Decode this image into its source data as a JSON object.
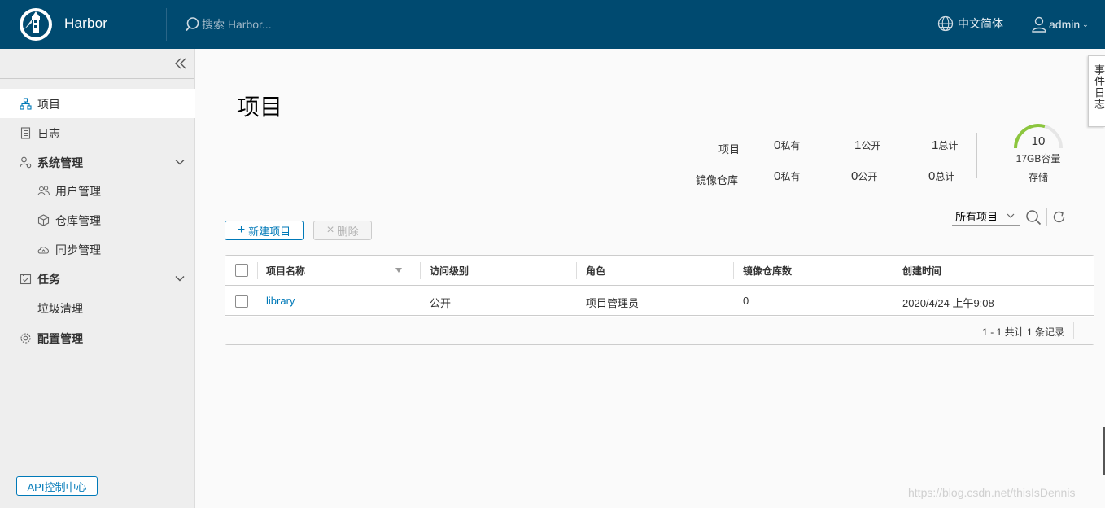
{
  "header": {
    "brand": "Harbor",
    "search_placeholder": "搜索 Harbor...",
    "language": "中文简体",
    "user": "admin"
  },
  "sidebar": {
    "items": [
      {
        "label": "项目",
        "icon": "projects-icon",
        "active": true
      },
      {
        "label": "日志",
        "icon": "log-icon"
      },
      {
        "label": "系统管理",
        "icon": "system-admin-icon",
        "expanded": true
      },
      {
        "label": "用户管理",
        "icon": "users-icon",
        "sub": true
      },
      {
        "label": "仓库管理",
        "icon": "registry-icon",
        "sub": true
      },
      {
        "label": "同步管理",
        "icon": "replication-icon",
        "sub": true
      },
      {
        "label": "任务",
        "icon": "tasks-icon",
        "expanded": true
      },
      {
        "label": "垃圾清理",
        "sub": true
      },
      {
        "label": "配置管理",
        "icon": "settings-icon"
      }
    ],
    "api_button": "API控制中心"
  },
  "main": {
    "title": "项目",
    "stats": {
      "project_label": "项目",
      "repo_label": "镜像仓库",
      "project_private": "0",
      "project_public": "1",
      "project_total": "1",
      "repo_private": "0",
      "repo_public": "0",
      "repo_total": "0",
      "private_unit": "私有",
      "public_unit": "公开",
      "total_unit": "总计"
    },
    "storage": {
      "value": "10",
      "capacity": "17GB容量",
      "label": "存储"
    },
    "new_button": "新建项目",
    "delete_button": "删除",
    "filter": "所有项目"
  },
  "table": {
    "columns": [
      "项目名称",
      "访问级别",
      "角色",
      "镜像仓库数",
      "创建时间"
    ],
    "rows": [
      {
        "name": "library",
        "access": "公开",
        "role": "项目管理员",
        "repos": "0",
        "created": "2020/4/24 上午9:08"
      }
    ],
    "footer": "1 - 1 共计 1 条记录"
  },
  "event_log_tab": "事件日志",
  "watermark": "https://blog.csdn.net/thisIsDennis",
  "colors": {
    "header": "#004a70",
    "accent": "#0079b8",
    "gauge": "#8cc63e"
  }
}
